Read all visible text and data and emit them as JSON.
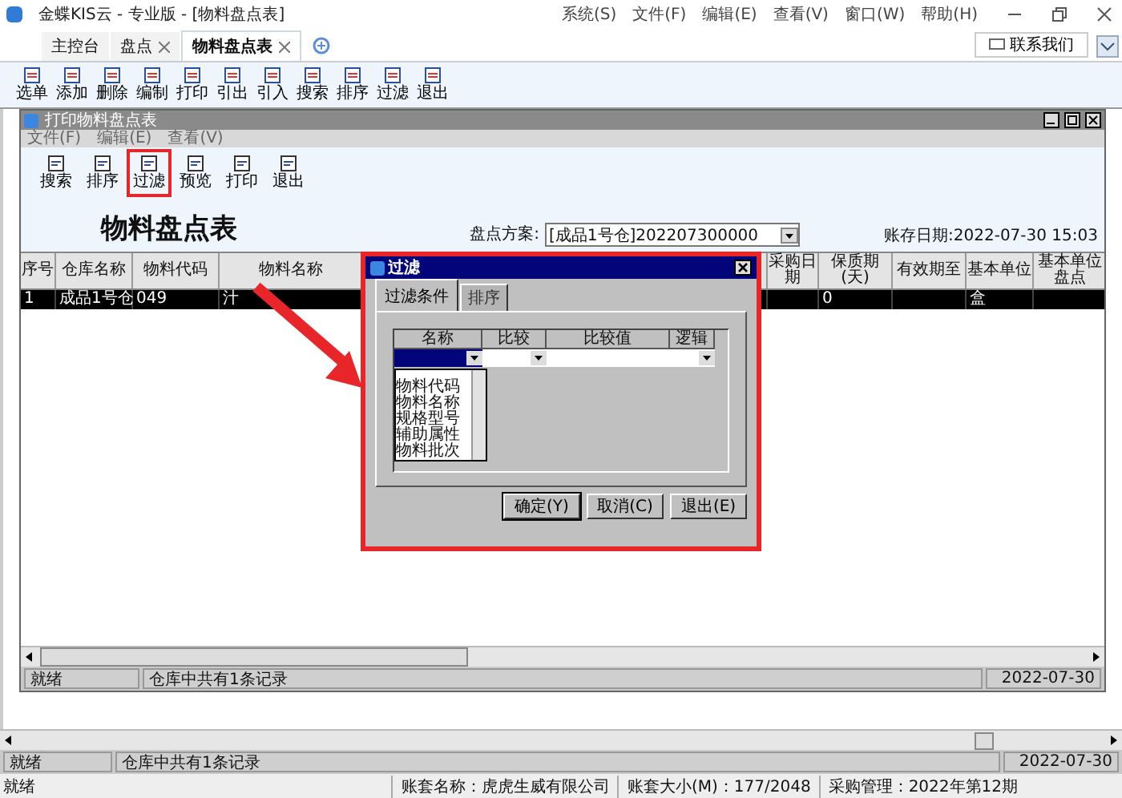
{
  "app": {
    "title": "金蝶KIS云 - 专业版 - [物料盘点表]",
    "menu": [
      "系统(S)",
      "文件(F)",
      "编辑(E)",
      "查看(V)",
      "窗口(W)",
      "帮助(H)"
    ]
  },
  "tabs": [
    {
      "label": "主控台",
      "selected": false,
      "closable": false
    },
    {
      "label": "盘点",
      "selected": false,
      "closable": true
    },
    {
      "label": "物料盘点表",
      "selected": true,
      "closable": true
    }
  ],
  "contact_button": "联系我们",
  "toolbar": [
    "选单",
    "添加",
    "删除",
    "编制",
    "打印",
    "引出",
    "引入",
    "搜索",
    "排序",
    "过滤",
    "退出"
  ],
  "report_window": {
    "title": "打印物料盘点表",
    "menu": [
      "文件(F)",
      "编辑(E)",
      "查看(V)"
    ],
    "toolbar": [
      {
        "label": "搜索",
        "highlighted": false
      },
      {
        "label": "排序",
        "highlighted": false
      },
      {
        "label": "过滤",
        "highlighted": true
      },
      {
        "label": "预览",
        "highlighted": false
      },
      {
        "label": "打印",
        "highlighted": false
      },
      {
        "label": "退出",
        "highlighted": false
      }
    ],
    "report_title": "物料盘点表",
    "scheme_label": "盘点方案:",
    "scheme_value": "[成品1号仓]202207300000",
    "stock_date": "账存日期:2022-07-30 15:03",
    "table": {
      "columns": [
        "序号",
        "仓库名称",
        "物料代码",
        "物料名称",
        "",
        "",
        "",
        "采购日期",
        "保质期(天)",
        "有效期至",
        "基本单位",
        "基本单位盘点"
      ],
      "rows": [
        [
          "1",
          "成品1号仓",
          "049",
          "汁",
          "",
          "",
          "",
          "",
          "0",
          "",
          "盒",
          ""
        ]
      ]
    },
    "status_bar": [
      "就绪",
      "仓库中共有1条记录",
      "2022-07-30"
    ]
  },
  "filter_dialog": {
    "title": "过滤",
    "tabs": [
      {
        "label": "过滤条件",
        "selected": true
      },
      {
        "label": "排序",
        "selected": false
      }
    ],
    "columns": [
      "名称",
      "比较",
      "比较值",
      "逻辑"
    ],
    "name_options": [
      "物料代码",
      "物料名称",
      "规格型号",
      "辅助属性",
      "物料批次"
    ],
    "buttons": [
      "确定(Y)",
      "取消(C)",
      "退出(E)"
    ]
  },
  "status_bar": [
    "就绪",
    "仓库中共有1条记录",
    "2022-07-30"
  ],
  "footer": [
    "就绪",
    "账套名称：虎虎生威有限公司",
    "账套大小(M)：177/2048",
    "采购管理：2022年第12期"
  ]
}
